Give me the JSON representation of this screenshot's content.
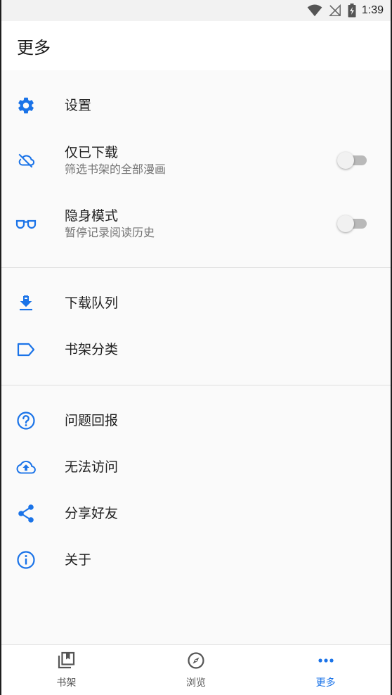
{
  "status_bar": {
    "time": "1:39"
  },
  "app_bar": {
    "title": "更多"
  },
  "colors": {
    "accent": "#1a73e8",
    "icon_gray": "#555555"
  },
  "sections": [
    {
      "items": [
        {
          "label": "设置",
          "icon": "gear-icon"
        },
        {
          "label": "仅已下载",
          "sub": "筛选书架的全部漫画",
          "icon": "cloud-off-icon",
          "toggle": false
        },
        {
          "label": "隐身模式",
          "sub": "暂停记录阅读历史",
          "icon": "glasses-icon",
          "toggle": false
        }
      ]
    },
    {
      "items": [
        {
          "label": "下载队列",
          "icon": "download-icon"
        },
        {
          "label": "书架分类",
          "icon": "label-icon"
        }
      ]
    },
    {
      "items": [
        {
          "label": "问题回报",
          "icon": "help-circle-icon"
        },
        {
          "label": "无法访问",
          "icon": "cloud-upload-icon"
        },
        {
          "label": "分享好友",
          "icon": "share-icon"
        },
        {
          "label": "关于",
          "icon": "info-icon"
        }
      ]
    }
  ],
  "bottom_nav": [
    {
      "label": "书架",
      "icon": "library-icon",
      "active": false
    },
    {
      "label": "浏览",
      "icon": "compass-icon",
      "active": false
    },
    {
      "label": "更多",
      "icon": "more-dots-icon",
      "active": true
    }
  ]
}
